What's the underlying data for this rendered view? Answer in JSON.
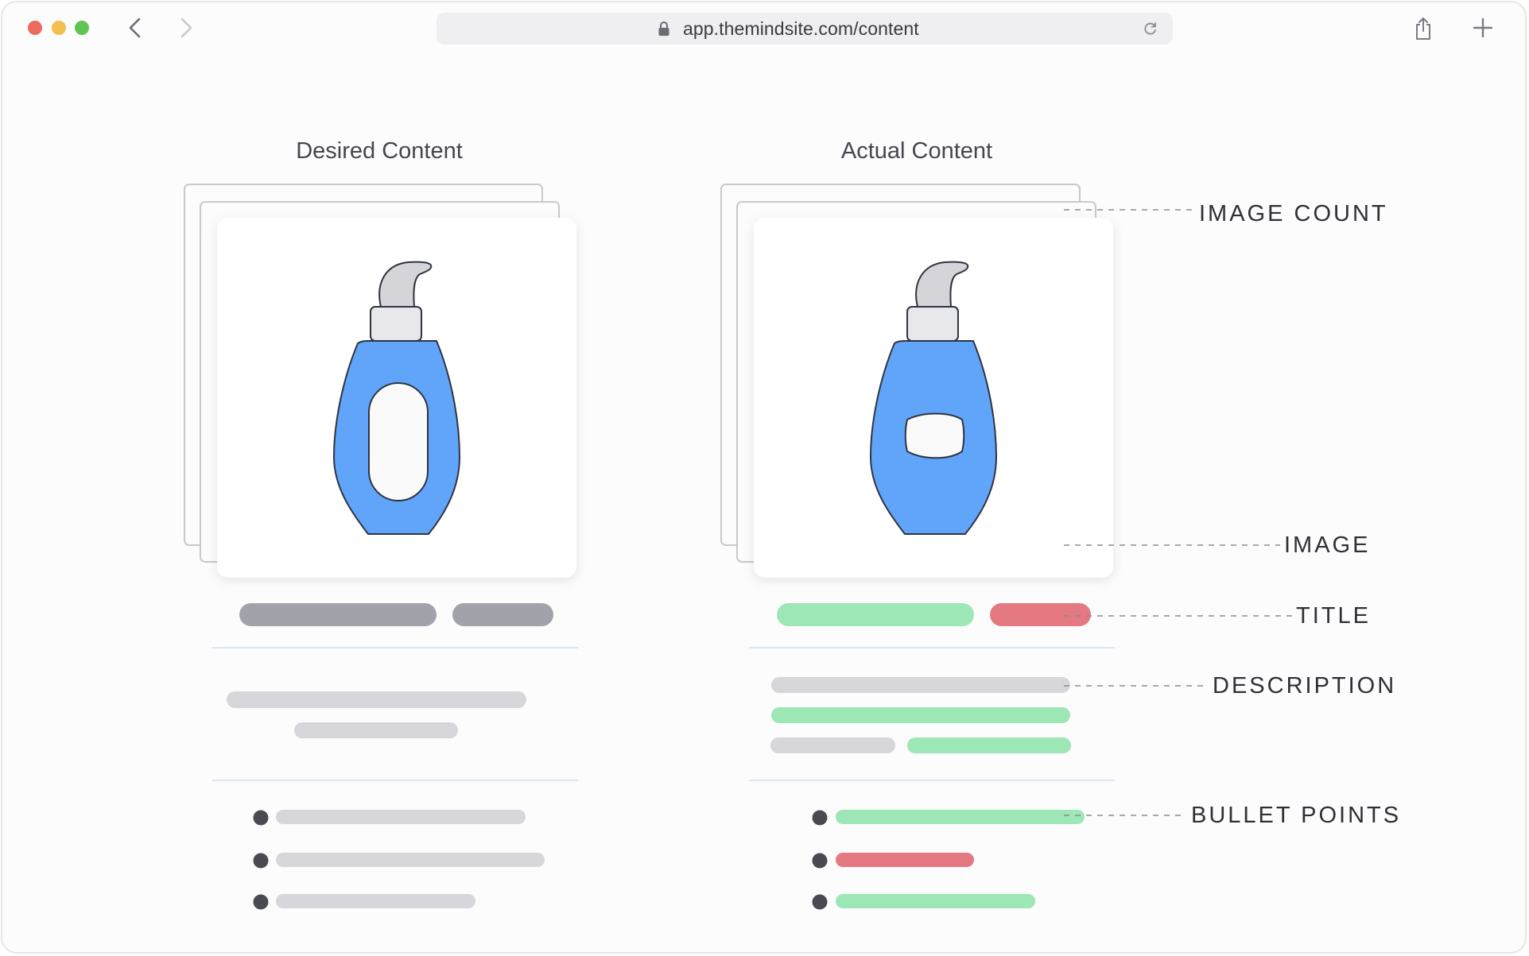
{
  "browser": {
    "url": "app.themindsite.com/content",
    "icons": [
      "close-window-icon",
      "minimize-window-icon",
      "zoom-window-icon",
      "back-icon",
      "forward-icon",
      "lock-icon",
      "reload-icon",
      "share-icon",
      "new-tab-icon"
    ]
  },
  "columns": {
    "desired_title": "Desired Content",
    "actual_title": "Actual Content"
  },
  "labels": {
    "image_count": "IMAGE COUNT",
    "image": "IMAGE",
    "title": "TITLE",
    "description": "DESCRIPTION",
    "bullet_points": "BULLET POINTS"
  },
  "colors": {
    "match": "#9de6b6",
    "mismatch": "#e57981",
    "neutral": "#d6d6db",
    "title_neutral": "#a2a2ab",
    "bottle_blue": "#60a5fa",
    "bullet": "#4a4a52"
  }
}
